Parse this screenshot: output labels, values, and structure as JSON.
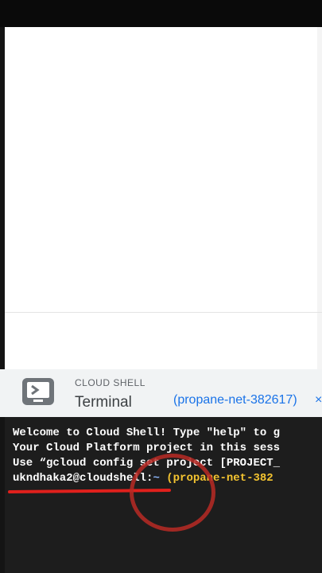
{
  "cloud_shell": {
    "section_label": "CLOUD SHELL",
    "tab_title": "Terminal",
    "project_tab": "(propane-net-382617)",
    "close_glyph": "×",
    "icon": "terminal-icon"
  },
  "terminal": {
    "lines": [
      "Welcome to Cloud Shell! Type \"help\" to g",
      "Your Cloud Platform project in this sess",
      "Use “gcloud config set project [PROJECT_"
    ],
    "prompt_user": "ukndhaka2@cloudshell:",
    "prompt_path": "~",
    "prompt_project": "(propane-net-382"
  },
  "colors": {
    "accent": "#1a73e8",
    "annotation_red": "#e0201c",
    "prompt_project": "#f4c430"
  }
}
